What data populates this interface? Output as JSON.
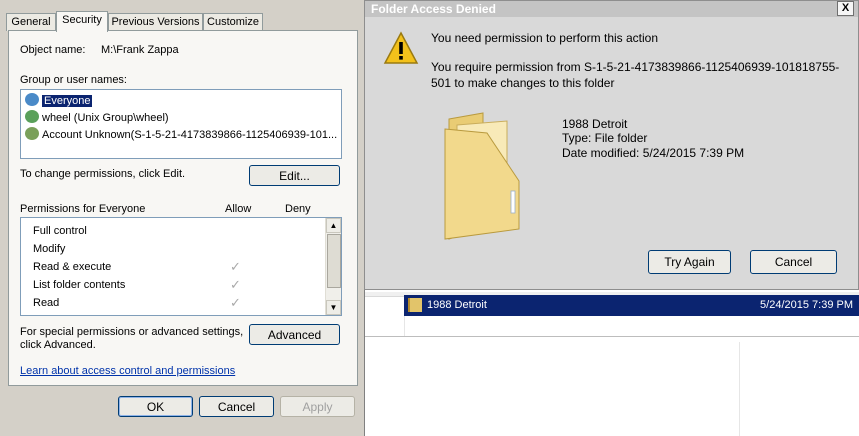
{
  "explorer": {
    "selected_file": {
      "name": "1988 Detroit",
      "date": "5/24/2015 7:39 PM"
    }
  },
  "properties": {
    "tabs": [
      {
        "label": "General",
        "active": false
      },
      {
        "label": "Security",
        "active": true
      },
      {
        "label": "Previous Versions",
        "active": false
      },
      {
        "label": "Customize",
        "active": false
      }
    ],
    "object_name_label": "Object name:",
    "object_name_value": "M:\\Frank Zappa",
    "group_label": "Group or user names:",
    "groups": [
      {
        "name": "Everyone",
        "selected": true
      },
      {
        "name": "wheel (Unix Group\\wheel)",
        "selected": false
      },
      {
        "name": "Account Unknown(S-1-5-21-4173839866-1125406939-101...",
        "selected": false
      }
    ],
    "change_hint": "To change permissions, click Edit.",
    "edit_button": "Edit...",
    "permissions_label": "Permissions for Everyone",
    "allow_header": "Allow",
    "deny_header": "Deny",
    "permissions": [
      {
        "name": "Full control",
        "allow": false
      },
      {
        "name": "Modify",
        "allow": false
      },
      {
        "name": "Read & execute",
        "allow": true
      },
      {
        "name": "List folder contents",
        "allow": true
      },
      {
        "name": "Read",
        "allow": true
      }
    ],
    "special_line1": "For special permissions or advanced settings,",
    "special_line2": "click Advanced.",
    "advanced_button": "Advanced",
    "learn_link": "Learn about access control and permissions",
    "ok_button": "OK",
    "cancel_button": "Cancel",
    "apply_button": "Apply"
  },
  "denied_dialog": {
    "title": "Folder Access Denied",
    "message": "You need permission to perform this action",
    "detail_line1": "You require permission from S-1-5-21-4173839866-1125406939-101818755-",
    "detail_line2": "501 to make changes to this folder",
    "folder_name": "1988 Detroit",
    "folder_type": "Type: File folder",
    "folder_modified": "Date modified: 5/24/2015 7:39 PM",
    "try_again_button": "Try Again",
    "cancel_button": "Cancel",
    "close_glyph": "X"
  }
}
